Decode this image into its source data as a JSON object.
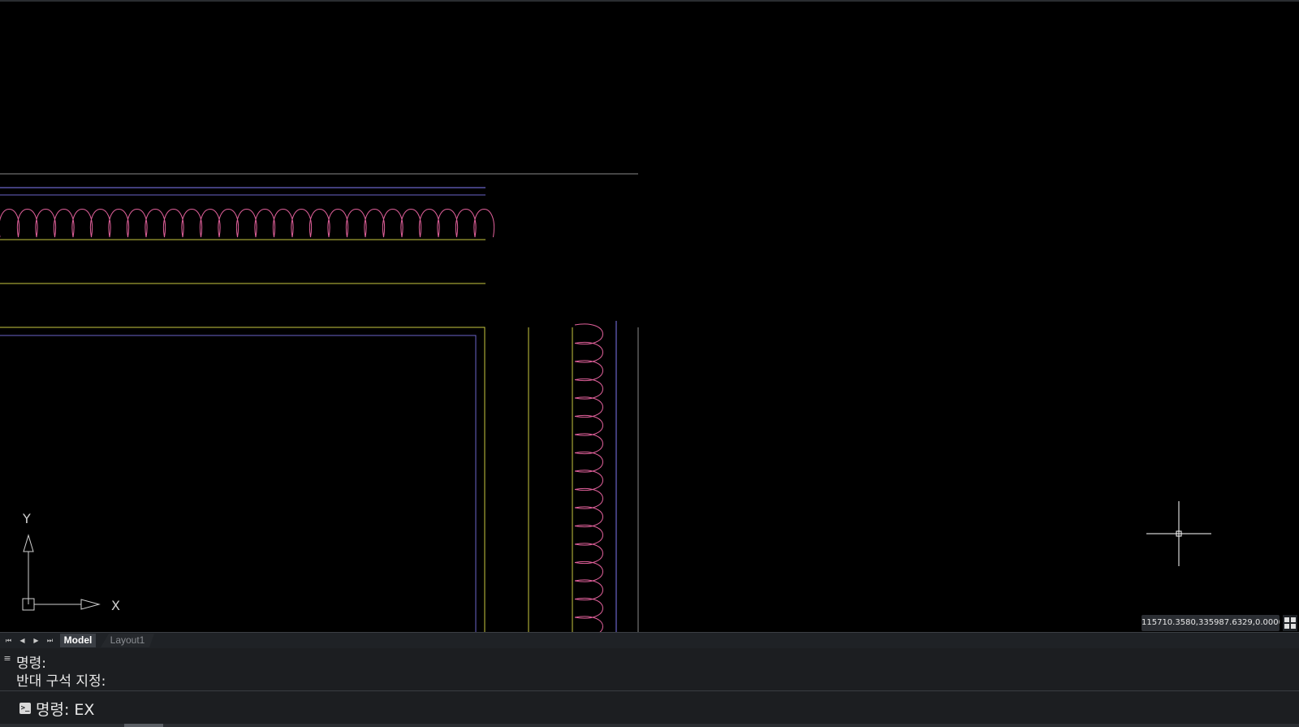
{
  "app": {
    "colors": {
      "background": "#000000",
      "magenta": "#e0609a",
      "yellow": "#c9c940",
      "blue": "#6a63c8",
      "gray": "#8a8a8a",
      "ucs": "#d0d0d0"
    }
  },
  "viewport": {
    "ucs": {
      "y_label": "Y",
      "x_label": "X",
      "icon": "ucs-axis-icon"
    },
    "crosshair_icon": "crosshair-cursor-icon",
    "coordinates": "115710.3580,335987.6329,0.0000",
    "grid_icon": "grid-toggle-icon"
  },
  "tabs": {
    "nav": [
      "⏮",
      "◀",
      "▶",
      "⏭"
    ],
    "items": [
      {
        "label": "Model",
        "active": true
      },
      {
        "label": "Layout1",
        "active": false
      }
    ]
  },
  "command": {
    "history": [
      "명령:",
      "반대 구석 지정:"
    ],
    "prompt": "명령: EX",
    "icon": "command-prompt-icon"
  }
}
